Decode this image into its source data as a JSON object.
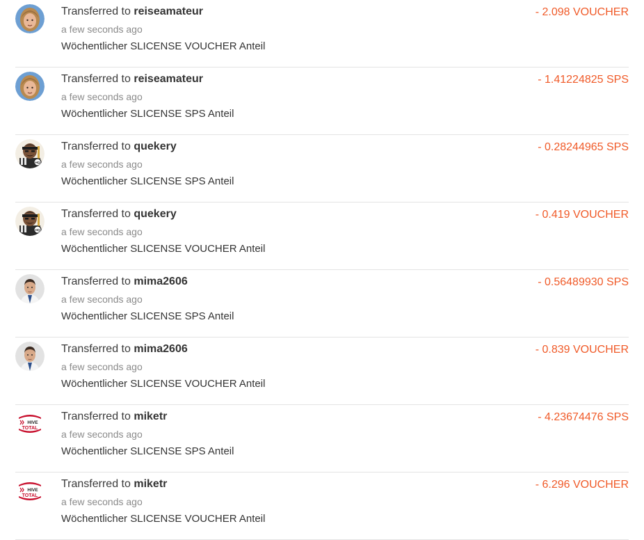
{
  "transfers": [
    {
      "prefix": "Transferred to",
      "user": "reiseamateur",
      "time": "a few seconds ago",
      "memo": "Wöchentlicher SLICENSE VOUCHER Anteil",
      "amount": "- 2.098 VOUCHER",
      "avatar": "reiseamateur-avatar"
    },
    {
      "prefix": "Transferred to",
      "user": "reiseamateur",
      "time": "a few seconds ago",
      "memo": "Wöchentlicher SLICENSE SPS Anteil",
      "amount": "- 1.41224825 SPS",
      "avatar": "reiseamateur-avatar"
    },
    {
      "prefix": "Transferred to",
      "user": "quekery",
      "time": "a few seconds ago",
      "memo": "Wöchentlicher SLICENSE SPS Anteil",
      "amount": "- 0.28244965 SPS",
      "avatar": "quekery-avatar"
    },
    {
      "prefix": "Transferred to",
      "user": "quekery",
      "time": "a few seconds ago",
      "memo": "Wöchentlicher SLICENSE VOUCHER Anteil",
      "amount": "- 0.419 VOUCHER",
      "avatar": "quekery-avatar"
    },
    {
      "prefix": "Transferred to",
      "user": "mima2606",
      "time": "a few seconds ago",
      "memo": "Wöchentlicher SLICENSE SPS Anteil",
      "amount": "- 0.56489930 SPS",
      "avatar": "mima2606-avatar"
    },
    {
      "prefix": "Transferred to",
      "user": "mima2606",
      "time": "a few seconds ago",
      "memo": "Wöchentlicher SLICENSE VOUCHER Anteil",
      "amount": "- 0.839 VOUCHER",
      "avatar": "mima2606-avatar"
    },
    {
      "prefix": "Transferred to",
      "user": "miketr",
      "time": "a few seconds ago",
      "memo": "Wöchentlicher SLICENSE SPS Anteil",
      "amount": "- 4.23674476 SPS",
      "avatar": "hive-total-logo"
    },
    {
      "prefix": "Transferred to",
      "user": "miketr",
      "time": "a few seconds ago",
      "memo": "Wöchentlicher SLICENSE VOUCHER Anteil",
      "amount": "- 6.296 VOUCHER",
      "avatar": "hive-total-logo"
    }
  ],
  "logo_text": {
    "hive": "HIVE",
    "total": "TOTAL"
  },
  "colors": {
    "amount": "#f05a28",
    "divider": "#e3e3e3",
    "muted": "#8b8b8b",
    "hive_red": "#c8102e"
  }
}
